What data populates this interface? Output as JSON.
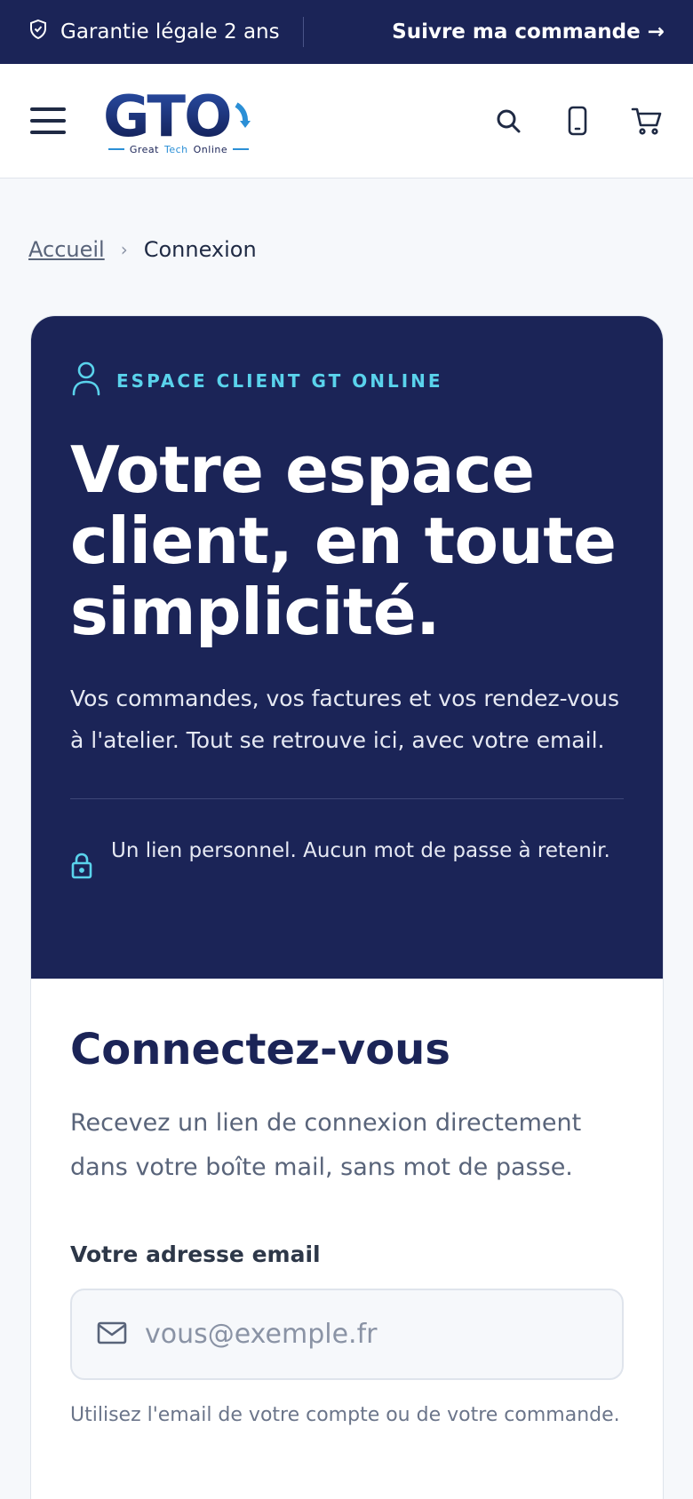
{
  "topbar": {
    "guarantee": "Garantie légale 2 ans",
    "track_order": "Suivre ma commande →"
  },
  "header": {
    "logo_text": "GTO",
    "logo_tagline_1": "Great",
    "logo_tagline_2": "Tech",
    "logo_tagline_3": "Online"
  },
  "breadcrumb": {
    "home": "Accueil",
    "separator": "›",
    "current": "Connexion"
  },
  "hero": {
    "eyebrow": "ESPACE CLIENT GT ONLINE",
    "title": "Votre espace client, en toute simplicité.",
    "lead": "Vos commandes, vos factures et vos rendez-vous à l'atelier. Tout se retrouve ici, avec votre email.",
    "note": "Un lien personnel. Aucun mot de passe à retenir."
  },
  "form": {
    "title": "Connectez-vous",
    "subtitle": "Recevez un lien de connexion directement dans votre boîte mail, sans mot de passe.",
    "email_label": "Votre adresse email",
    "email_placeholder": "vous@exemple.fr",
    "email_value": "",
    "email_help": "Utilisez l'email de votre compte ou de votre commande."
  },
  "icons": {
    "guarantee": "shield-check-icon",
    "menu": "hamburger-menu-icon",
    "search": "search-icon",
    "phone": "phone-icon",
    "cart": "cart-icon",
    "user": "user-icon",
    "lock": "lock-icon",
    "mail": "mail-icon"
  },
  "colors": {
    "navy": "#1b2457",
    "accent_cyan": "#5ad3ec",
    "logo_blue": "#2b8fd6"
  }
}
